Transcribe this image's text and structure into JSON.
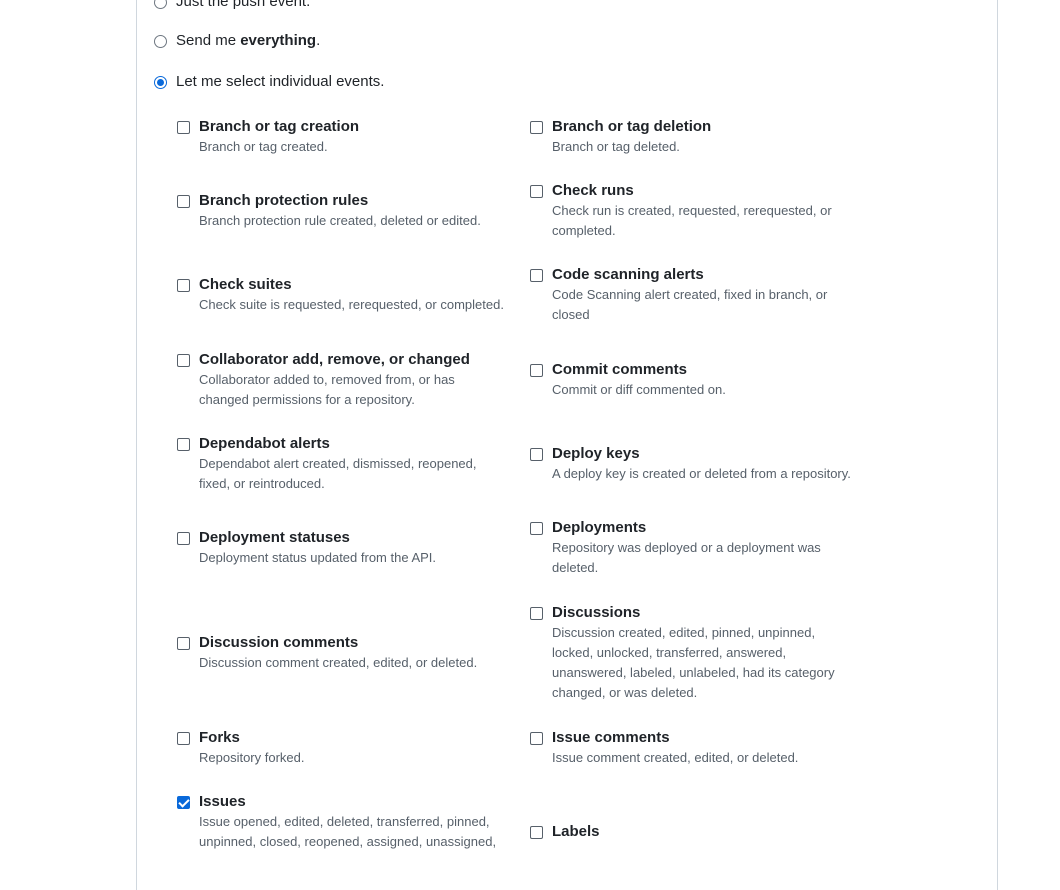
{
  "radio_options": [
    {
      "text": "Just the push event.",
      "checked": false
    },
    {
      "text_before": "Send me ",
      "text_bold": "everything",
      "text_after": ".",
      "checked": false
    },
    {
      "text": "Let me select individual events.",
      "checked": true
    }
  ],
  "events": [
    {
      "title": "Branch or tag creation",
      "desc": "Branch or tag created.",
      "checked": false
    },
    {
      "title": "Branch or tag deletion",
      "desc": "Branch or tag deleted.",
      "checked": false
    },
    {
      "title": "Branch protection rules",
      "desc": "Branch protection rule created, deleted or edited.",
      "checked": false
    },
    {
      "title": "Check runs",
      "desc_lines": [
        "Check run is created, requested, rerequested, or",
        "completed."
      ],
      "checked": false
    },
    {
      "title": "Check suites",
      "desc": "Check suite is requested, rerequested, or completed.",
      "checked": false
    },
    {
      "title": "Code scanning alerts",
      "desc_lines": [
        "Code Scanning alert created, fixed in branch, or",
        "closed"
      ],
      "checked": false
    },
    {
      "title": "Collaborator add, remove, or changed",
      "desc_lines": [
        "Collaborator added to, removed from, or has",
        "changed permissions for a repository."
      ],
      "checked": false
    },
    {
      "title": "Commit comments",
      "desc": "Commit or diff commented on.",
      "checked": false
    },
    {
      "title": "Dependabot alerts",
      "desc_lines": [
        "Dependabot alert created, dismissed, reopened,",
        "fixed, or reintroduced."
      ],
      "checked": false
    },
    {
      "title": "Deploy keys",
      "desc": "A deploy key is created or deleted from a repository.",
      "checked": false
    },
    {
      "title": "Deployment statuses",
      "desc": "Deployment status updated from the API.",
      "checked": false
    },
    {
      "title": "Deployments",
      "desc_lines": [
        "Repository was deployed or a deployment was",
        "deleted."
      ],
      "checked": false
    },
    {
      "title": "Discussion comments",
      "desc": "Discussion comment created, edited, or deleted.",
      "checked": false
    },
    {
      "title": "Discussions",
      "desc_lines": [
        "Discussion created, edited, pinned, unpinned,",
        "locked, unlocked, transferred, answered,",
        "unanswered, labeled, unlabeled, had its category",
        "changed, or was deleted."
      ],
      "checked": false
    },
    {
      "title": "Forks",
      "desc": "Repository forked.",
      "checked": false
    },
    {
      "title": "Issue comments",
      "desc": "Issue comment created, edited, or deleted.",
      "checked": false
    },
    {
      "title": "Issues",
      "desc_lines": [
        "Issue opened, edited, deleted, transferred, pinned,",
        "unpinned, closed, reopened, assigned, unassigned,"
      ],
      "checked": true
    },
    {
      "title": "Labels",
      "checked": false
    }
  ]
}
